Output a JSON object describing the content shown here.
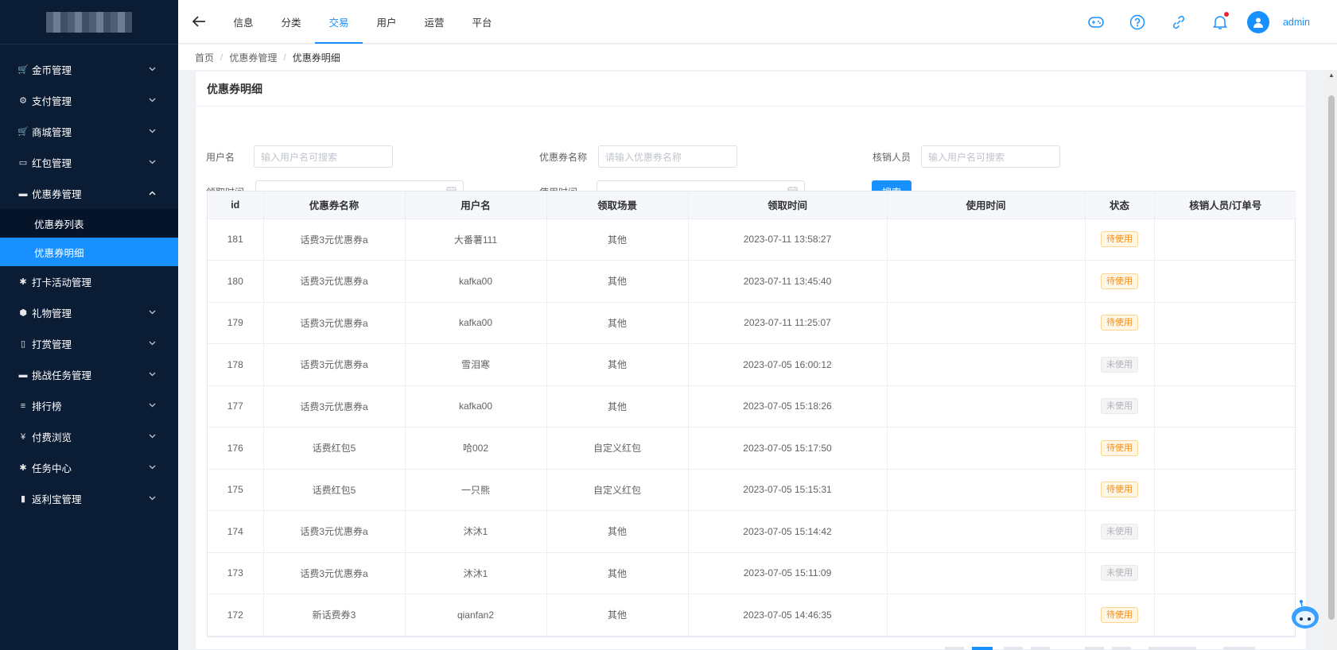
{
  "sidebar": {
    "items": [
      {
        "label": "金币管理",
        "icon": "cart-icon",
        "glyph": "🛒"
      },
      {
        "label": "支付管理",
        "icon": "gear-icon",
        "glyph": "⚙"
      },
      {
        "label": "商城管理",
        "icon": "cart-icon",
        "glyph": "🛒"
      },
      {
        "label": "红包管理",
        "icon": "gift-icon",
        "glyph": "▭"
      },
      {
        "label": "优惠券管理",
        "icon": "card-icon",
        "glyph": "▬",
        "expanded": true
      }
    ],
    "sub_items": [
      "优惠券列表",
      "优惠券明细"
    ],
    "items_after": [
      {
        "label": "打卡活动管理",
        "icon": "asterisk-icon",
        "glyph": "✱"
      },
      {
        "label": "礼物管理",
        "icon": "cube-icon",
        "glyph": "⬢"
      },
      {
        "label": "打赏管理",
        "icon": "clipboard-icon",
        "glyph": "▯"
      },
      {
        "label": "挑战任务管理",
        "icon": "keyboard-icon",
        "glyph": "▬"
      },
      {
        "label": "排行榜",
        "icon": "list-icon",
        "glyph": "≡"
      },
      {
        "label": "付费浏览",
        "icon": "yen-icon",
        "glyph": "¥"
      },
      {
        "label": "任务中心",
        "icon": "asterisk-icon",
        "glyph": "✱"
      },
      {
        "label": "返利宝管理",
        "icon": "bookmark-icon",
        "glyph": "▮"
      }
    ]
  },
  "topbar": {
    "tabs": [
      "信息",
      "分类",
      "交易",
      "用户",
      "运营",
      "平台"
    ],
    "active_tab": "交易",
    "user": "admin"
  },
  "breadcrumb": [
    "首页",
    "优惠券管理",
    "优惠券明细"
  ],
  "card": {
    "title": "优惠券明细"
  },
  "filters": {
    "username_label": "用户名",
    "username_placeholder": "输入用户名可搜索",
    "coupon_name_label": "优惠券名称",
    "coupon_name_placeholder": "请输入优惠券名称",
    "verifier_label": "核销人员",
    "verifier_placeholder": "输入用户名可搜索",
    "claim_time_label": "领取时间",
    "use_time_label": "使用时间",
    "search_button": "搜索"
  },
  "table": {
    "columns": [
      "id",
      "优惠券名称",
      "用户名",
      "领取场景",
      "领取时间",
      "使用时间",
      "状态",
      "核销人员/订单号"
    ],
    "rows": [
      {
        "id": "181",
        "name": "话费3元优惠券a",
        "user": "大番薯111",
        "scene": "其他",
        "claim_time": "2023-07-11 13:58:27",
        "use_time": "",
        "status": "待使用",
        "status_type": "pending",
        "verifier": ""
      },
      {
        "id": "180",
        "name": "话费3元优惠券a",
        "user": "kafka00",
        "scene": "其他",
        "claim_time": "2023-07-11 13:45:40",
        "use_time": "",
        "status": "待使用",
        "status_type": "pending",
        "verifier": ""
      },
      {
        "id": "179",
        "name": "话费3元优惠券a",
        "user": "kafka00",
        "scene": "其他",
        "claim_time": "2023-07-11 11:25:07",
        "use_time": "",
        "status": "待使用",
        "status_type": "pending",
        "verifier": ""
      },
      {
        "id": "178",
        "name": "话费3元优惠券a",
        "user": "雪泪寒",
        "scene": "其他",
        "claim_time": "2023-07-05 16:00:12",
        "use_time": "",
        "status": "未使用",
        "status_type": "unused",
        "verifier": ""
      },
      {
        "id": "177",
        "name": "话费3元优惠券a",
        "user": "kafka00",
        "scene": "其他",
        "claim_time": "2023-07-05 15:18:26",
        "use_time": "",
        "status": "未使用",
        "status_type": "unused",
        "verifier": ""
      },
      {
        "id": "176",
        "name": "话费红包5",
        "user": "哈002",
        "scene": "自定义红包",
        "claim_time": "2023-07-05 15:17:50",
        "use_time": "",
        "status": "待使用",
        "status_type": "pending",
        "verifier": ""
      },
      {
        "id": "175",
        "name": "话费红包5",
        "user": "一只熊",
        "scene": "自定义红包",
        "claim_time": "2023-07-05 15:15:31",
        "use_time": "",
        "status": "待使用",
        "status_type": "pending",
        "verifier": ""
      },
      {
        "id": "174",
        "name": "话费3元优惠券a",
        "user": "沐沐1",
        "scene": "其他",
        "claim_time": "2023-07-05 15:14:42",
        "use_time": "",
        "status": "未使用",
        "status_type": "unused",
        "verifier": ""
      },
      {
        "id": "173",
        "name": "话费3元优惠券a",
        "user": "沐沐1",
        "scene": "其他",
        "claim_time": "2023-07-05 15:11:09",
        "use_time": "",
        "status": "未使用",
        "status_type": "unused",
        "verifier": ""
      },
      {
        "id": "172",
        "name": "新话费券3",
        "user": "qianfan2",
        "scene": "其他",
        "claim_time": "2023-07-05 14:46:35",
        "use_time": "",
        "status": "待使用",
        "status_type": "pending",
        "verifier": ""
      }
    ]
  },
  "colors": {
    "accent": "#1890ff",
    "sidebar_bg": "#0b1d35",
    "pending": "#fa8c16",
    "unused": "#b0b3b8"
  }
}
